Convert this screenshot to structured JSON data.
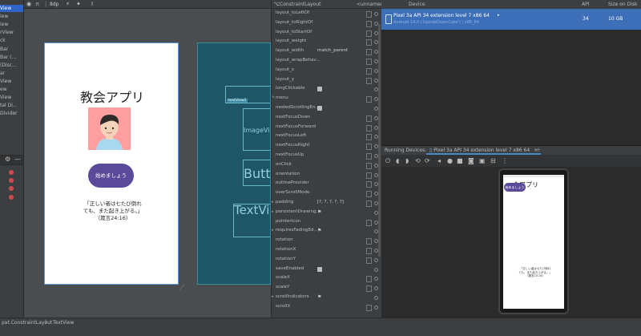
{
  "component_tree": {
    "items": [
      {
        "label": "View",
        "selected": true
      },
      {
        "label": "iew",
        "selected": false
      },
      {
        "label": "iew",
        "selected": false
      },
      {
        "label": "rView",
        "selected": false
      },
      {
        "label": "ck",
        "selected": false
      },
      {
        "label": "Bar",
        "selected": false
      },
      {
        "label": "Bar (...",
        "selected": false
      },
      {
        "label": "(Disc...",
        "selected": false
      },
      {
        "label": "ar",
        "selected": false
      },
      {
        "label": "View",
        "selected": false
      },
      {
        "label": "ew",
        "selected": false
      },
      {
        "label": "View",
        "selected": false
      },
      {
        "label": "tal Di...",
        "selected": false
      },
      {
        "label": "Divider",
        "selected": false
      }
    ]
  },
  "design_toolbar": {
    "zoom_icon": "zoom-icon",
    "dp_label": "8dp"
  },
  "design_preview": {
    "title": "教会アプリ",
    "button_label": "始めましょう",
    "verse_lines": [
      "「正しい者は七たび倒れ",
      "ても、また起き上がる。」",
      "（箴言24:16）"
    ],
    "avatar_color": "#ff9f9f"
  },
  "blueprint": {
    "image_label": "ImageView",
    "button_label": "Butto",
    "text_label": "TextVi",
    "title_chip": "textView2"
  },
  "attributes": {
    "header_title": "ConstraintLayout",
    "header_value": "<unnamed>",
    "rows": [
      {
        "name": "layout_toLeftOf",
        "value": "",
        "kind": "text",
        "expand": false
      },
      {
        "name": "layout_toRightOf",
        "value": "",
        "kind": "text",
        "expand": false
      },
      {
        "name": "layout_toStartOf",
        "value": "",
        "kind": "text",
        "expand": false
      },
      {
        "name": "layout_weight",
        "value": "",
        "kind": "text",
        "expand": false
      },
      {
        "name": "layout_width",
        "value": "match_parent",
        "kind": "text",
        "expand": false
      },
      {
        "name": "layout_wrapBehav...",
        "value": "",
        "kind": "text",
        "expand": false
      },
      {
        "name": "layout_x",
        "value": "",
        "kind": "text",
        "expand": false
      },
      {
        "name": "layout_y",
        "value": "",
        "kind": "text",
        "expand": false
      },
      {
        "name": "longClickable",
        "value": "",
        "kind": "mini",
        "expand": false
      },
      {
        "name": "menu",
        "value": "",
        "kind": "text",
        "expand": false,
        "wrench": true
      },
      {
        "name": "nestedScrollingEn...",
        "value": "",
        "kind": "mini",
        "expand": false
      },
      {
        "name": "nextFocusDown",
        "value": "",
        "kind": "text",
        "expand": false
      },
      {
        "name": "nextFocusForward",
        "value": "",
        "kind": "text",
        "expand": false
      },
      {
        "name": "nextFocusLeft",
        "value": "",
        "kind": "text",
        "expand": false
      },
      {
        "name": "nextFocusRight",
        "value": "",
        "kind": "text",
        "expand": false
      },
      {
        "name": "nextFocusUp",
        "value": "",
        "kind": "text",
        "expand": false
      },
      {
        "name": "onClick",
        "value": "",
        "kind": "text",
        "expand": false
      },
      {
        "name": "orientation",
        "value": "",
        "kind": "text",
        "expand": false
      },
      {
        "name": "outlineProvider",
        "value": "",
        "kind": "text",
        "expand": false
      },
      {
        "name": "overScrollMode",
        "value": "",
        "kind": "text",
        "expand": false
      },
      {
        "name": "padding",
        "value": "[?, ?, ?, ?, ?]",
        "kind": "text",
        "expand": true
      },
      {
        "name": "persistentDrawing...",
        "value": "",
        "kind": "flag",
        "expand": true
      },
      {
        "name": "pointerIcon",
        "value": "",
        "kind": "text",
        "expand": false
      },
      {
        "name": "requiresFadingEd...",
        "value": "",
        "kind": "flag",
        "expand": true
      },
      {
        "name": "rotation",
        "value": "",
        "kind": "text",
        "expand": false
      },
      {
        "name": "rotationX",
        "value": "",
        "kind": "text",
        "expand": false
      },
      {
        "name": "rotationY",
        "value": "",
        "kind": "text",
        "expand": false
      },
      {
        "name": "saveEnabled",
        "value": "",
        "kind": "mini",
        "expand": false
      },
      {
        "name": "scaleX",
        "value": "",
        "kind": "text",
        "expand": false
      },
      {
        "name": "scaleY",
        "value": "",
        "kind": "text",
        "expand": false
      },
      {
        "name": "scrollIndicators",
        "value": "",
        "kind": "flag",
        "expand": true
      },
      {
        "name": "scrollX",
        "value": "",
        "kind": "text",
        "expand": false
      }
    ]
  },
  "device_manager": {
    "columns": [
      "Device",
      "API",
      "Size on Disk"
    ],
    "device": {
      "name": "Pixel 3a API 34 extension level 7 x86 64",
      "subtitle": "Android 14.0 ('UpsideDownCake') | x86_64",
      "api": "34",
      "size": "10 GB"
    }
  },
  "running_devices": {
    "label": "Running Devices:",
    "tab_label": "Pixel 3a API 34 extension level 7 x86 64",
    "close_icon": "close-icon",
    "add_icon": "add-icon"
  },
  "emulator_screen": {
    "title": "会アプリ",
    "button_label": "始めましょう",
    "verse_lines": [
      "「正しい者は七たび倒れ",
      "ても、また起き上がる。」",
      "（箴言24:16）"
    ]
  },
  "status_bar": {
    "crumb_1": "pat.ConstraintLayout",
    "separator": "〉",
    "crumb_2": "TextView"
  }
}
